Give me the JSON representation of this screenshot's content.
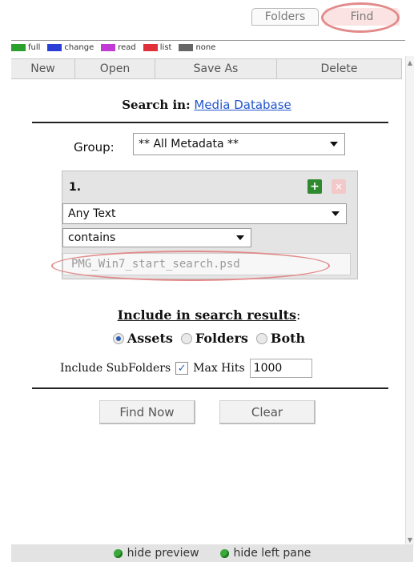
{
  "tabs": {
    "folders": "Folders",
    "find": "Find"
  },
  "legend": [
    {
      "label": "full",
      "color": "#2ca02c"
    },
    {
      "label": "change",
      "color": "#2b3fd6"
    },
    {
      "label": "read",
      "color": "#c23ad6"
    },
    {
      "label": "list",
      "color": "#e0303a"
    },
    {
      "label": "none",
      "color": "#666666"
    }
  ],
  "toolbar": {
    "new": "New",
    "open": "Open",
    "save_as": "Save As",
    "delete": "Delete"
  },
  "search_in": {
    "label": "Search in:",
    "link": "Media Database"
  },
  "group": {
    "label": "Group:",
    "value": "** All Metadata **"
  },
  "criteria": {
    "number": "1.",
    "field": "Any Text",
    "operator": "contains",
    "value": "PMG_Win7_start_search.psd"
  },
  "include": {
    "title": "Include in search results",
    "colon": ":",
    "options": [
      "Assets",
      "Folders",
      "Both"
    ],
    "subfolders_label": "Include SubFolders",
    "max_hits_label": "Max Hits",
    "max_hits_value": "1000"
  },
  "buttons": {
    "find_now": "Find Now",
    "clear": "Clear"
  },
  "footer": {
    "hide_preview": "hide preview",
    "hide_left_pane": "hide left pane"
  }
}
